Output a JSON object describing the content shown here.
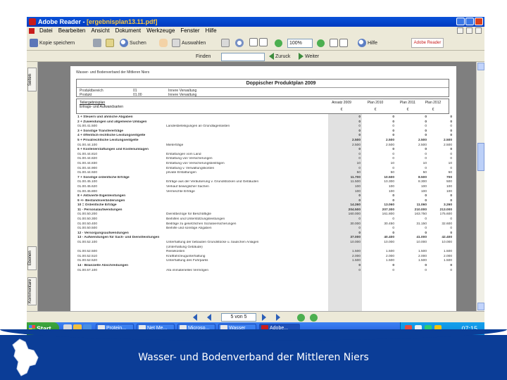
{
  "window": {
    "title_app": "Adobe Reader - ",
    "title_file": "[ergebnisplan13.11.pdf]"
  },
  "menubar": {
    "items": [
      "Datei",
      "Bearbeiten",
      "Ansicht",
      "Dokument",
      "Werkzeuge",
      "Fenster",
      "Hilfe"
    ]
  },
  "toolbar": {
    "save_label": "Kopie speichern",
    "search_label": "Suchen",
    "select_label": "Auswahlen",
    "zoom_value": "100%",
    "help_label": "Hilfe",
    "logo_text": "Adobe Reader"
  },
  "toolbar2": {
    "find_label": "Finden",
    "back_label": "Zuruck",
    "forward_label": "Weiter"
  },
  "sidetabs": [
    "Seiten",
    "Ebenen",
    "Kommentare"
  ],
  "document": {
    "org": "Wasser- und Bodenverband der Mittleren Niers",
    "title": "Doppischer Produktplan 2009",
    "meta": [
      [
        "Produktbereich",
        "01",
        "Innere Verwaltung"
      ],
      [
        "Produkt",
        "01.00",
        "Innere Verwaltung"
      ]
    ],
    "table_head": [
      "Teilergebnisplan",
      "Ertrags- und Aufwandsarten"
    ],
    "years": [
      "Ansatz 2009",
      "Plan 2010",
      "Plan 2011",
      "Plan 2012"
    ],
    "year_units": [
      "€",
      "€",
      "€",
      "€"
    ],
    "rows": [
      [
        "1 + Steuern und ahnliche Abgaben",
        "",
        "0",
        "0",
        "0",
        "0"
      ],
      [
        "2 + Zuwendungen und allgemeine Umlagen",
        "",
        "0",
        "0",
        "0",
        "0"
      ],
      [
        "01.00.41.500",
        "Landesbeteiligungen an Grundlagenlasten",
        "0",
        "0",
        "0",
        "0"
      ],
      [
        "3 + Sonstige Transfererträge",
        "",
        "0",
        "0",
        "0",
        "0"
      ],
      [
        "4 + öffentlich-rechtliche Leistungsentgelte",
        "",
        "0",
        "0",
        "0",
        "0"
      ],
      [
        "5 + Privatrechtliche Leistungsentgelte",
        "",
        "2.500",
        "2.500",
        "2.500",
        "2.500"
      ],
      [
        "01.00.44.100",
        "Mieterträge",
        "2.500",
        "2.500",
        "2.500",
        "2.500"
      ],
      [
        "6 + Kostenerstattungen und Kostenumlagen",
        "",
        "0",
        "0",
        "0",
        "0"
      ],
      [
        "01.00.44.810",
        "Erstattungen vom Land",
        "0",
        "0",
        "0",
        "0"
      ],
      [
        "01.00.44.820",
        "Erstattung von Versicherungen",
        "0",
        "0",
        "0",
        "0"
      ],
      [
        "01.00.44.830",
        "Erstattung von Versicherungsbeiträgen",
        "10",
        "10",
        "10",
        "10"
      ],
      [
        "01.00.44.900",
        "Erstattung v. Verwaltungskosten",
        "0",
        "0",
        "0",
        "0"
      ],
      [
        "01.00.44.920",
        "private Erstattungen",
        "50",
        "50",
        "50",
        "50"
      ],
      [
        "7 + Sonstige ordentliche Erträge",
        "",
        "11.700",
        "10.500",
        "8.500",
        "700"
      ],
      [
        "01.00.45.100",
        "Erträge aus der Veräußerung v. Grundstücken und Gebäuden",
        "11.500",
        "10.300",
        "8.300",
        "500"
      ],
      [
        "01.00.45.620",
        "Verkauf beweglicher Sachen",
        "100",
        "100",
        "100",
        "100"
      ],
      [
        "01.00.45.800",
        "Vermischte Erträge",
        "100",
        "100",
        "100",
        "100"
      ],
      [
        "8 + Aktivierte Eigenleistungen",
        "",
        "0",
        "0",
        "0",
        "0"
      ],
      [
        "9 +/- Bestandsveränderungen",
        "",
        "0",
        "0",
        "0",
        "0"
      ],
      [
        "10 = Ordentliche Erträge",
        "",
        "14.260",
        "13.060",
        "11.060",
        "3.260"
      ],
      [
        "11 - Personalaufwendungen",
        "",
        "204.500",
        "207.300",
        "210.000",
        "213.000"
      ],
      [
        "01.00.50.200",
        "Dienstbezüge für Beschäftigte",
        "160.000",
        "161.800",
        "163.750",
        "175.600"
      ],
      [
        "01.00.50.300",
        "Beihilfen und Unterstützungsleistungen",
        "0",
        "0",
        "0",
        "0"
      ],
      [
        "01.00.50.400",
        "Beiträge zu gesetzlichen Sozialversicherungen",
        "30.000",
        "30.450",
        "31.150",
        "32.600"
      ],
      [
        "01.00.50.500",
        "Beihilfe und sonstige Abgaben",
        "0",
        "0",
        "0",
        "0"
      ],
      [
        "12 - Versorgungsaufwendungen",
        "",
        "0",
        "0",
        "0",
        "0"
      ],
      [
        "13 - Aufwendungen für Sach- und Dienstleistungen",
        "",
        "37.000",
        "40.400",
        "41.000",
        "42.400"
      ],
      [
        "01.00.52.100",
        "Unterhaltung der bebauten Grundstücke u. baulichen Anlagen",
        "10.000",
        "10.000",
        "10.000",
        "10.000"
      ],
      [
        "",
        "(Unterhaltung Gebäude)",
        "",
        "",
        "",
        ""
      ],
      [
        "01.00.52.500",
        "Reisekosten",
        "1.500",
        "1.500",
        "1.500",
        "1.500"
      ],
      [
        "01.00.52.510",
        "Kraftfahrzeugunterhaltung",
        "2.000",
        "2.000",
        "2.000",
        "2.000"
      ],
      [
        "01.00.52.520",
        "Unterhaltung des Fuhrparks",
        "1.500",
        "1.500",
        "1.500",
        "1.500"
      ],
      [
        "14 - Bilanzielle Abschreibungen",
        "",
        "0",
        "0",
        "0",
        "0"
      ],
      [
        "01.00.57.100",
        "Afa immaterielles Vermögen",
        "0",
        "0",
        "0",
        "0"
      ]
    ]
  },
  "navbar": {
    "page_indicator": "5 von 5"
  },
  "taskbar": {
    "start_label": "Start",
    "tasks": [
      "Protein...",
      "Net Me...",
      "Microso...",
      "Wasser",
      "Adobe..."
    ],
    "clock": "07:15"
  },
  "slide": {
    "footer_text": "Wasser- und Bodenverband der Mittleren Niers"
  }
}
